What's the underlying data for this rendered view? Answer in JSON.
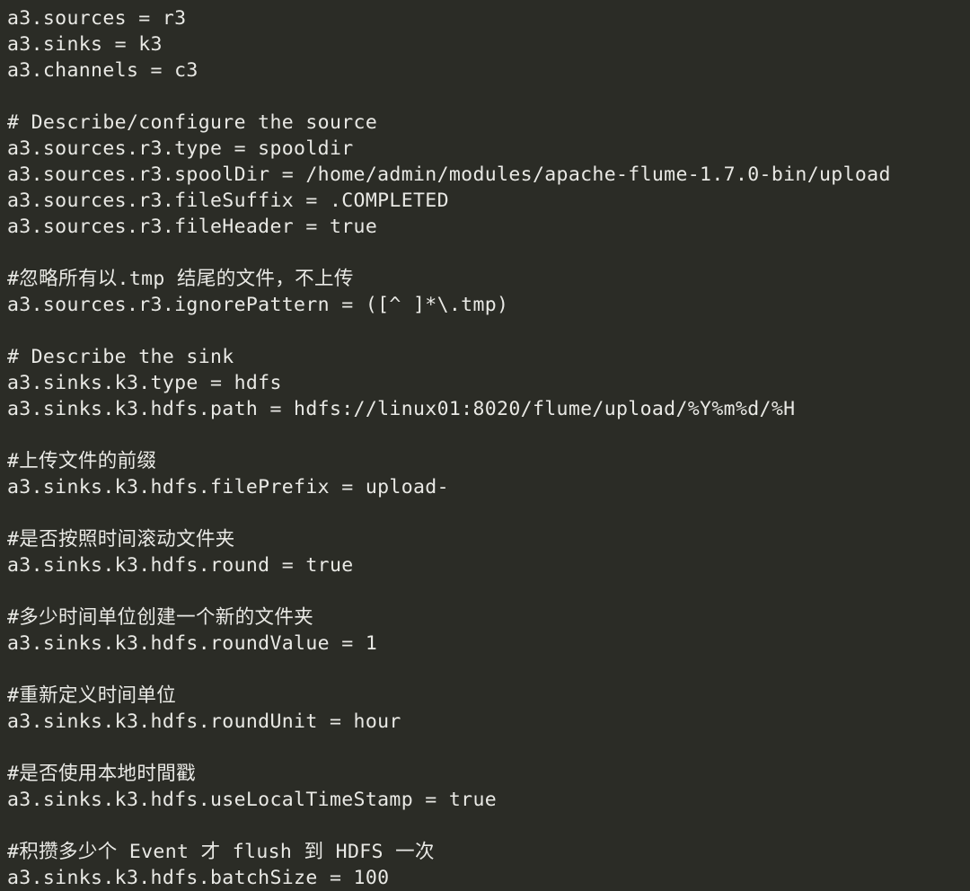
{
  "editor": {
    "theme": {
      "background": "#2b2c26",
      "foreground": "#e9e9e5"
    },
    "language": "properties",
    "lines": [
      {
        "text": "a3.sources = r3",
        "kind": "property"
      },
      {
        "text": "a3.sinks = k3",
        "kind": "property"
      },
      {
        "text": "a3.channels = c3",
        "kind": "property"
      },
      {
        "text": "",
        "kind": "blank"
      },
      {
        "text": "# Describe/configure the source",
        "kind": "comment"
      },
      {
        "text": "a3.sources.r3.type = spooldir",
        "kind": "property"
      },
      {
        "text": "a3.sources.r3.spoolDir = /home/admin/modules/apache-flume-1.7.0-bin/upload",
        "kind": "property"
      },
      {
        "text": "a3.sources.r3.fileSuffix = .COMPLETED",
        "kind": "property"
      },
      {
        "text": "a3.sources.r3.fileHeader = true",
        "kind": "property"
      },
      {
        "text": "",
        "kind": "blank"
      },
      {
        "text": "#忽略所有以.tmp 结尾的文件，不上传",
        "kind": "comment"
      },
      {
        "text": "a3.sources.r3.ignorePattern = ([^ ]*\\.tmp)",
        "kind": "property"
      },
      {
        "text": "",
        "kind": "blank"
      },
      {
        "text": "# Describe the sink",
        "kind": "comment"
      },
      {
        "text": "a3.sinks.k3.type = hdfs",
        "kind": "property"
      },
      {
        "text": "a3.sinks.k3.hdfs.path = hdfs://linux01:8020/flume/upload/%Y%m%d/%H",
        "kind": "property"
      },
      {
        "text": "",
        "kind": "blank"
      },
      {
        "text": "#上传文件的前缀",
        "kind": "comment"
      },
      {
        "text": "a3.sinks.k3.hdfs.filePrefix = upload-",
        "kind": "property"
      },
      {
        "text": "",
        "kind": "blank"
      },
      {
        "text": "#是否按照时间滚动文件夹",
        "kind": "comment"
      },
      {
        "text": "a3.sinks.k3.hdfs.round = true",
        "kind": "property"
      },
      {
        "text": "",
        "kind": "blank"
      },
      {
        "text": "#多少时间单位创建一个新的文件夹",
        "kind": "comment"
      },
      {
        "text": "a3.sinks.k3.hdfs.roundValue = 1",
        "kind": "property"
      },
      {
        "text": "",
        "kind": "blank"
      },
      {
        "text": "#重新定义时间单位",
        "kind": "comment"
      },
      {
        "text": "a3.sinks.k3.hdfs.roundUnit = hour",
        "kind": "property"
      },
      {
        "text": "",
        "kind": "blank"
      },
      {
        "text": "#是否使用本地时間戳",
        "kind": "comment"
      },
      {
        "text": "a3.sinks.k3.hdfs.useLocalTimeStamp = true",
        "kind": "property"
      },
      {
        "text": "",
        "kind": "blank"
      },
      {
        "text": "#积攒多少个 Event 才 flush 到 HDFS 一次",
        "kind": "comment"
      },
      {
        "text": "a3.sinks.k3.hdfs.batchSize = 100",
        "kind": "property"
      }
    ]
  }
}
